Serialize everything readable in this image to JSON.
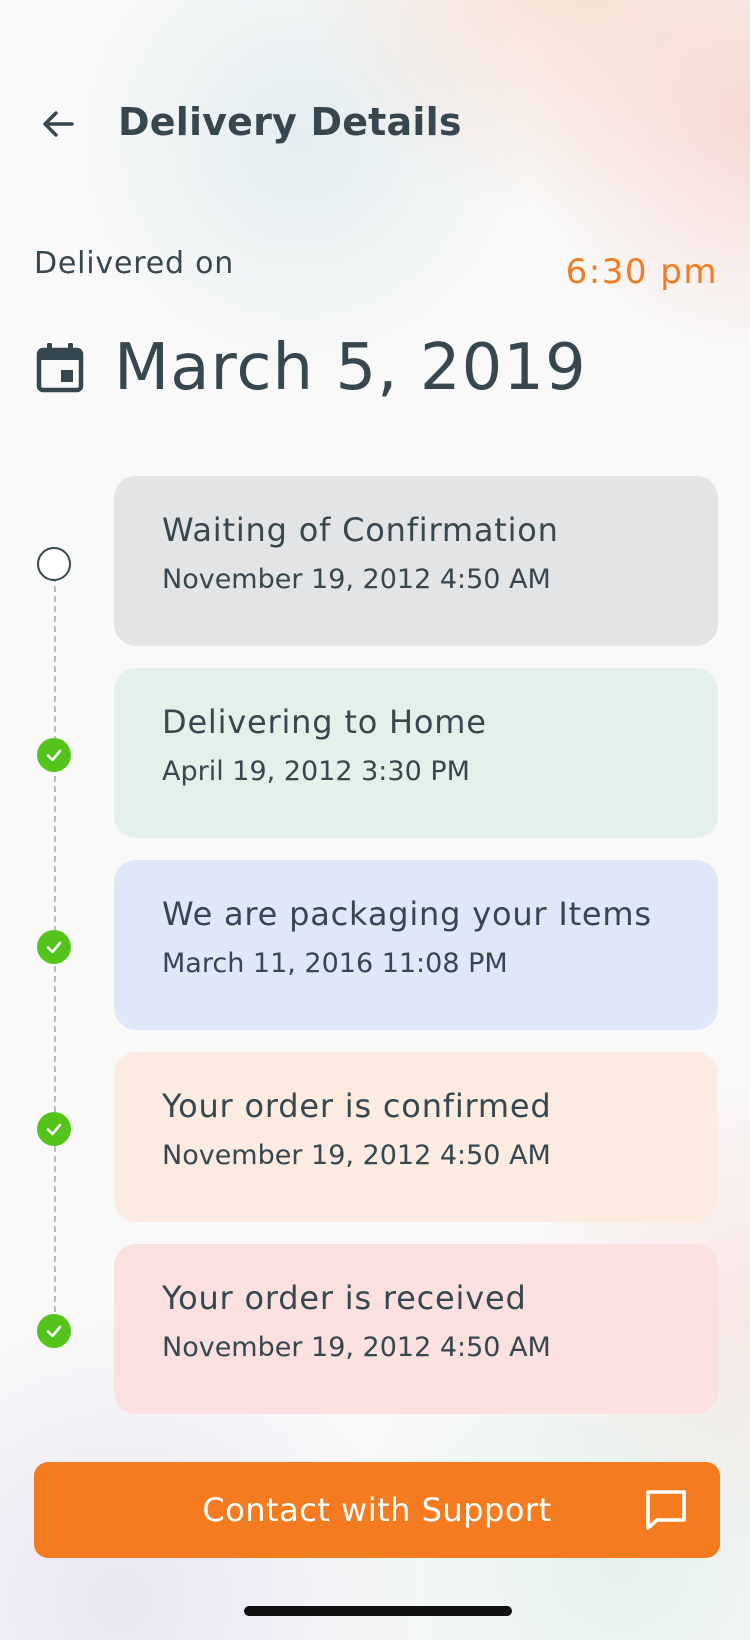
{
  "header": {
    "title": "Delivery Details"
  },
  "delivery": {
    "label": "Delivered on",
    "time": "6:30 pm",
    "date": "March 5, 2019"
  },
  "timeline": [
    {
      "title": "Waiting of Confirmation",
      "date": "November 19, 2012 4:50 AM",
      "status": "pending",
      "color": "#e3e4e6"
    },
    {
      "title": "Delivering to Home",
      "date": "April 19, 2012 3:30 PM",
      "status": "done",
      "color": "#e2f1ea"
    },
    {
      "title": "We are packaging your Items",
      "date": "March 11, 2016 11:08 PM",
      "status": "done",
      "color": "#dfe8f8"
    },
    {
      "title": "Your order is confirmed",
      "date": "November 19, 2012 4:50 AM",
      "status": "done",
      "color": "#fbebe0"
    },
    {
      "title": "Your order is received",
      "date": "November 19, 2012 4:50 AM",
      "status": "done",
      "color": "#fbe0e0"
    }
  ],
  "support": {
    "label": "Contact with Support"
  },
  "colors": {
    "accent": "#f47b20",
    "done": "#52c41a",
    "text": "#37474f"
  },
  "icons": {
    "back": "arrow-left-icon",
    "calendar": "calendar-icon",
    "chat": "chat-icon",
    "check": "check-icon"
  }
}
